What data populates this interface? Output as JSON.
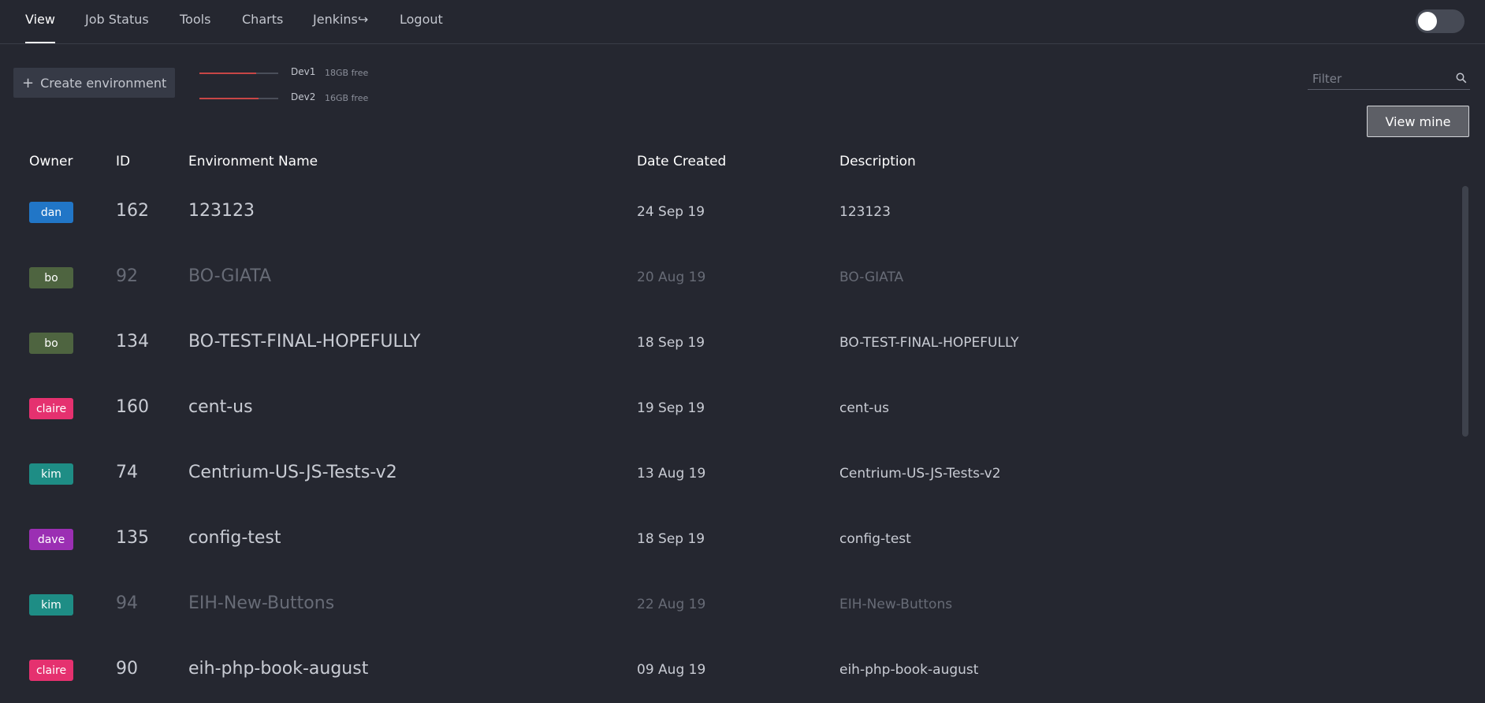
{
  "nav": {
    "items": [
      {
        "label": "View",
        "active": true
      },
      {
        "label": "Job Status",
        "active": false
      },
      {
        "label": "Tools",
        "active": false
      },
      {
        "label": "Charts",
        "active": false
      },
      {
        "label": "Jenkins↪",
        "active": false
      },
      {
        "label": "Logout",
        "active": false
      }
    ],
    "theme_toggle": {
      "on": false
    }
  },
  "toolbar": {
    "create_label": "Create environment",
    "create_icon": "plus-icon",
    "servers": [
      {
        "name": "Dev1",
        "free": "18GB free",
        "usage_fraction": 0.72
      },
      {
        "name": "Dev2",
        "free": "16GB free",
        "usage_fraction": 0.75
      }
    ],
    "filter_placeholder": "Filter",
    "filter_icon": "search-icon",
    "view_mine_label": "View mine"
  },
  "table": {
    "headers": {
      "owner": "Owner",
      "id": "ID",
      "name": "Environment Name",
      "date": "Date Created",
      "description": "Description"
    },
    "rows": [
      {
        "owner": "dan",
        "owner_color": "#2176c7",
        "id": "162",
        "name": "123123",
        "date": "24 Sep 19",
        "description": "123123",
        "dim": false
      },
      {
        "owner": "bo",
        "owner_color": "#4e6440",
        "id": "92",
        "name": "BO-GIATA",
        "date": "20 Aug 19",
        "description": "BO-GIATA",
        "dim": true
      },
      {
        "owner": "bo",
        "owner_color": "#4e6440",
        "id": "134",
        "name": "BO-TEST-FINAL-HOPEFULLY",
        "date": "18 Sep 19",
        "description": "BO-TEST-FINAL-HOPEFULLY",
        "dim": false
      },
      {
        "owner": "claire",
        "owner_color": "#e5316f",
        "id": "160",
        "name": "cent-us",
        "date": "19 Sep 19",
        "description": "cent-us",
        "dim": false
      },
      {
        "owner": "kim",
        "owner_color": "#1e8d85",
        "id": "74",
        "name": "Centrium-US-JS-Tests-v2",
        "date": "13 Aug 19",
        "description": "Centrium-US-JS-Tests-v2",
        "dim": false
      },
      {
        "owner": "dave",
        "owner_color": "#9b2fb3",
        "id": "135",
        "name": "config-test",
        "date": "18 Sep 19",
        "description": "config-test",
        "dim": false
      },
      {
        "owner": "kim",
        "owner_color": "#1e8d85",
        "id": "94",
        "name": "EIH-New-Buttons",
        "date": "22 Aug 19",
        "description": "EIH-New-Buttons",
        "dim": true
      },
      {
        "owner": "claire",
        "owner_color": "#e5316f",
        "id": "90",
        "name": "eih-php-book-august",
        "date": "09 Aug 19",
        "description": "eih-php-book-august",
        "dim": false
      }
    ]
  }
}
